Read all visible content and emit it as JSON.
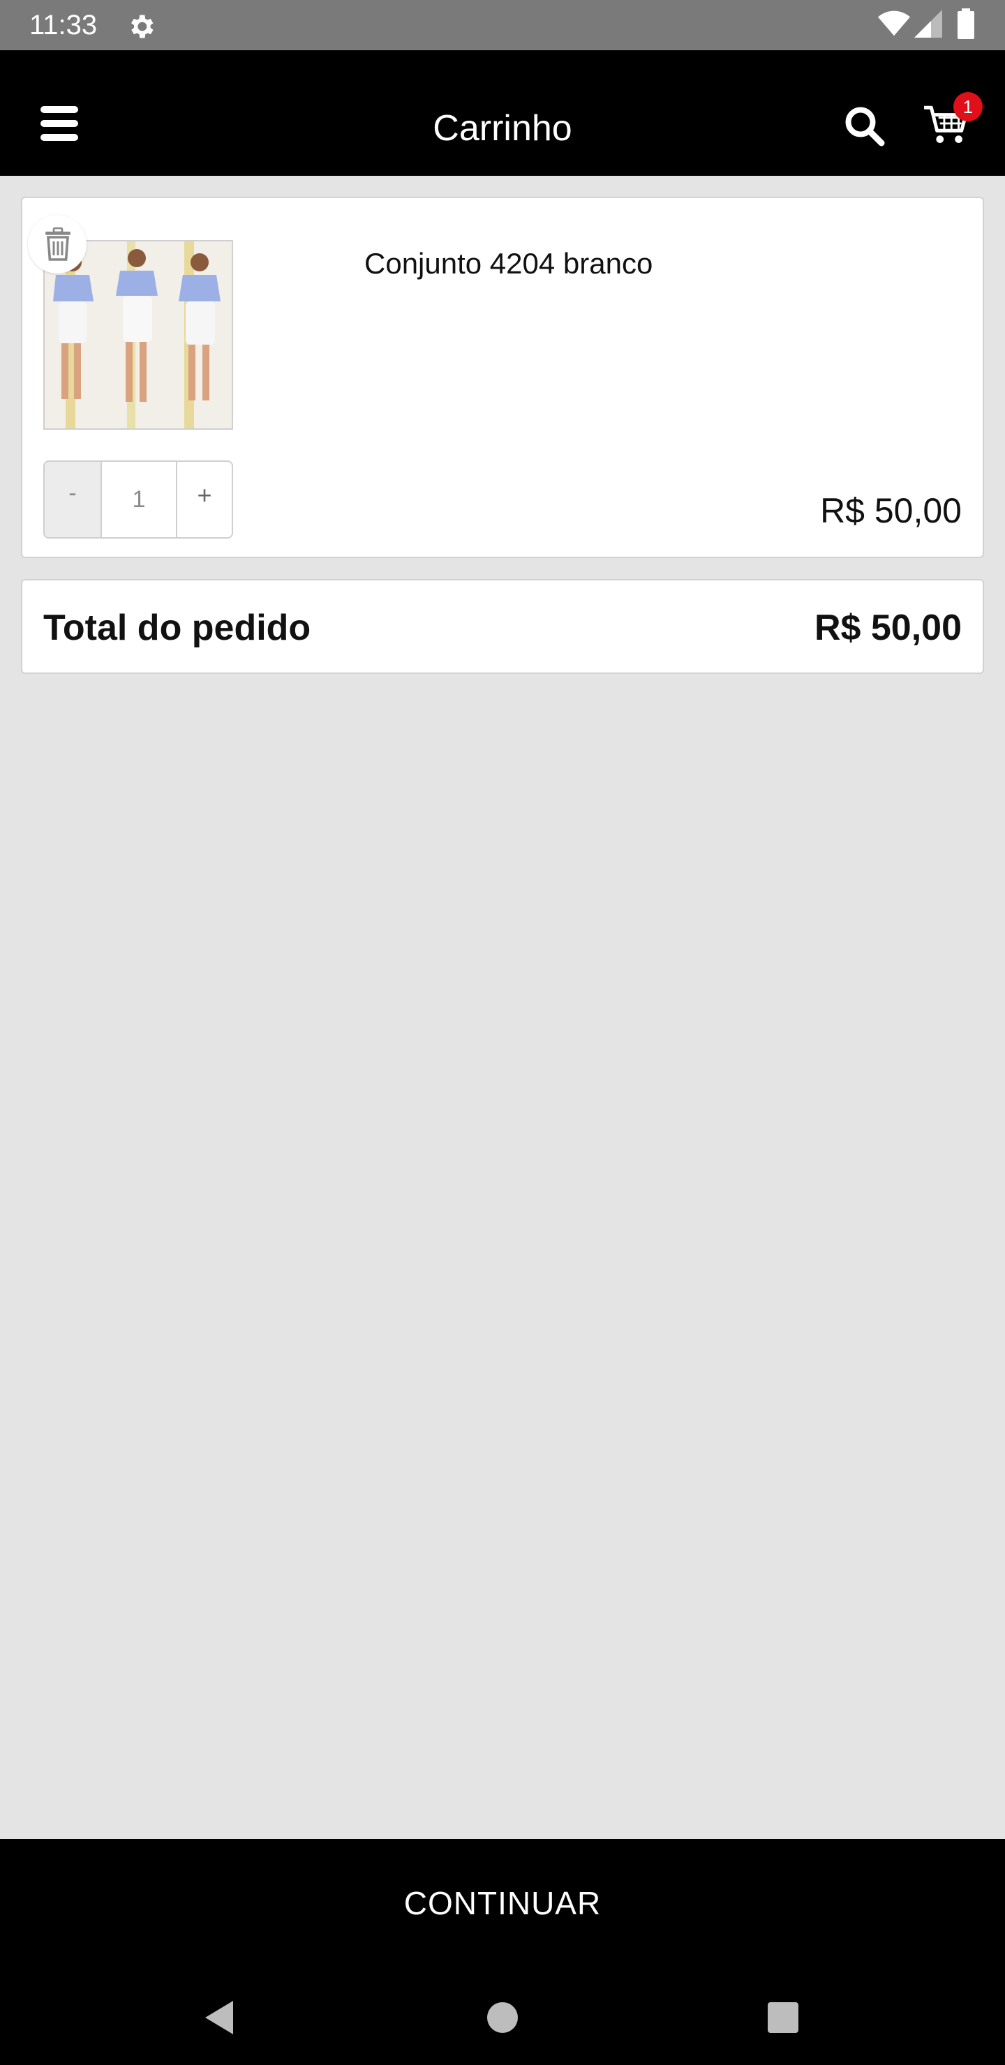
{
  "status_bar": {
    "time": "11:33"
  },
  "app_bar": {
    "title": "Carrinho",
    "cart_badge_count": "1"
  },
  "cart": {
    "items": [
      {
        "name": "Conjunto 4204 branco",
        "quantity": "1",
        "quantity_minus_label": "-",
        "quantity_plus_label": "+",
        "price": "R$ 50,00"
      }
    ],
    "total_label": "Total do pedido",
    "total_value": "R$ 50,00"
  },
  "actions": {
    "continue_label": "CONTINUAR"
  },
  "colors": {
    "app_bar": "#000000",
    "background": "#e4e4e4",
    "badge": "#e0101a"
  }
}
